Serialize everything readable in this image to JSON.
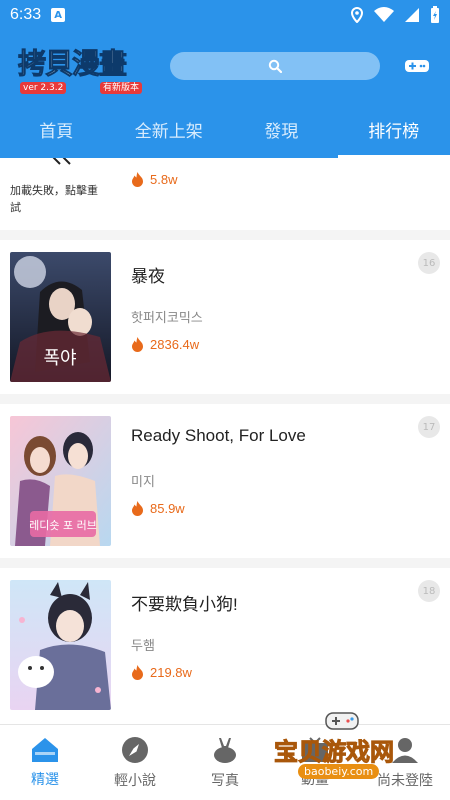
{
  "status": {
    "time": "6:33",
    "notif_letter": "A"
  },
  "app": {
    "logo_title": "拷貝漫畫",
    "version": "ver 2.3.2",
    "new_version": "有新版本"
  },
  "tabs": [
    {
      "label": "首頁"
    },
    {
      "label": "全新上架"
    },
    {
      "label": "發現"
    },
    {
      "label": "排行榜"
    }
  ],
  "list": {
    "partial_item": {
      "fail_text": "加載失敗，點擊重試",
      "hot": "5.8w"
    },
    "items": [
      {
        "rank": "16",
        "title": "暴夜",
        "author": "핫퍼지코믹스",
        "hot": "2836.4w",
        "cover_text": "폭야"
      },
      {
        "rank": "17",
        "title": "Ready Shoot, For Love",
        "author": "미지",
        "hot": "85.9w",
        "cover_text": "레디숏 포 러브"
      },
      {
        "rank": "18",
        "title": "不要欺負小狗!",
        "author": "두햄",
        "hot": "219.8w",
        "cover_text": ""
      }
    ]
  },
  "bottom_nav": [
    {
      "label": "精選"
    },
    {
      "label": "輕小說"
    },
    {
      "label": "写真"
    },
    {
      "label": "動畫"
    },
    {
      "label": "尚未登陸"
    }
  ],
  "watermark": {
    "text": "宝贝游戏网",
    "url": "baobeiy.com"
  },
  "colors": {
    "primary": "#2b93ea",
    "hot": "#e86a1b",
    "inactive_tab": "#d8ecfd"
  }
}
